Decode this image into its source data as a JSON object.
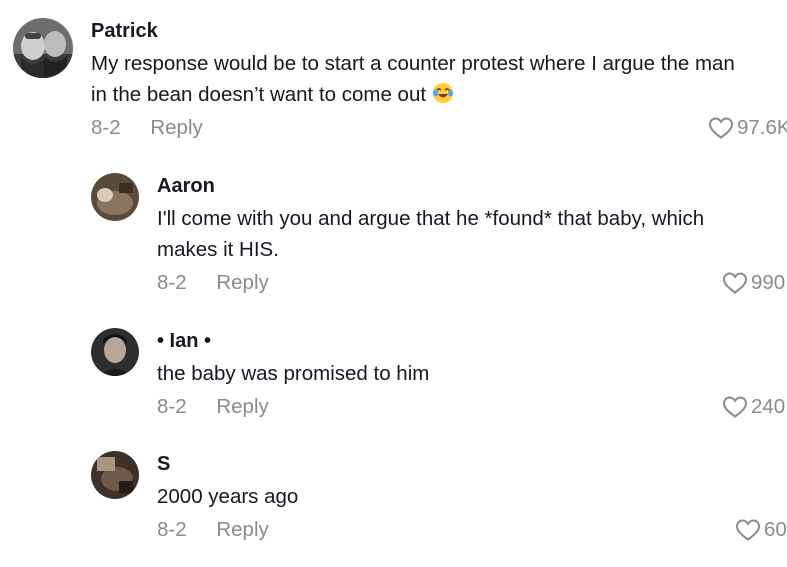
{
  "comments": [
    {
      "username": "Patrick",
      "text_lines": [
        "My response would be to start a counter protest where I argue the man",
        "in the bean doesn’t want to come out"
      ],
      "emoji": "laughing-tears-emoji",
      "date": "8-2",
      "reply_label": "Reply",
      "likes": "97.6K"
    },
    {
      "username": "Aaron",
      "text_lines": [
        "I'll come with you and argue that he *found* that baby, which",
        "makes it HIS."
      ],
      "date": "8-2",
      "reply_label": "Reply",
      "likes": "990"
    },
    {
      "username": "• Ian •",
      "text_lines": [
        "the baby was promised to him"
      ],
      "date": "8-2",
      "reply_label": "Reply",
      "likes": "240"
    },
    {
      "username": "S",
      "text_lines": [
        "2000 years ago"
      ],
      "date": "8-2",
      "reply_label": "Reply",
      "likes": "60"
    }
  ],
  "icons": {
    "like": "heart-outline-icon"
  },
  "colors": {
    "text": "#161823",
    "meta": "#8a8b91"
  }
}
